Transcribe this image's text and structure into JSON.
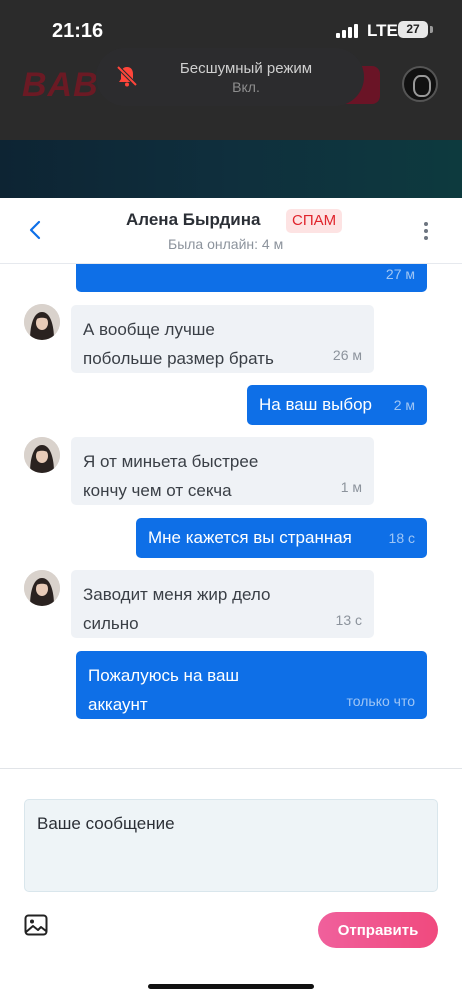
{
  "status_bar": {
    "time": "21:16",
    "network": "LTE",
    "battery": "27"
  },
  "background_app": {
    "logo_text": "BABY"
  },
  "toast": {
    "title": "Бесшумный режим",
    "subtitle": "Вкл."
  },
  "chat": {
    "contact_name": "Алена Бырдина",
    "badge": "СПАМ",
    "last_seen": "Была онлайн: 4 м"
  },
  "messages": [
    {
      "direction": "out",
      "lines": [
        ""
      ],
      "time": "27 м"
    },
    {
      "direction": "in",
      "lines": [
        "А вообще лучше",
        "побольше размер брать"
      ],
      "time": "26 м"
    },
    {
      "direction": "out",
      "lines": [
        "На ваш выбор"
      ],
      "time": "2 м"
    },
    {
      "direction": "in",
      "lines": [
        "Я от миньета быстрее",
        "кончу чем от секча"
      ],
      "time": "1 м"
    },
    {
      "direction": "out",
      "lines": [
        "Мне кажется вы странная"
      ],
      "time": "18 с"
    },
    {
      "direction": "in",
      "lines": [
        "Заводит меня жир дело",
        "сильно"
      ],
      "time": "13 с"
    },
    {
      "direction": "out",
      "lines": [
        "Пожалуюсь на ваш",
        "аккаунт"
      ],
      "time": "только что"
    }
  ],
  "composer": {
    "placeholder": "Ваше сообщение",
    "send_label": "Отправить"
  },
  "colors": {
    "accent": "#0e6fe7",
    "spam": "#e0242c",
    "send": "#f04a7e"
  },
  "icons": {
    "back": "chevron-left-icon",
    "more": "more-vertical-icon",
    "attach": "image-icon",
    "silent": "bell-slash-icon"
  }
}
